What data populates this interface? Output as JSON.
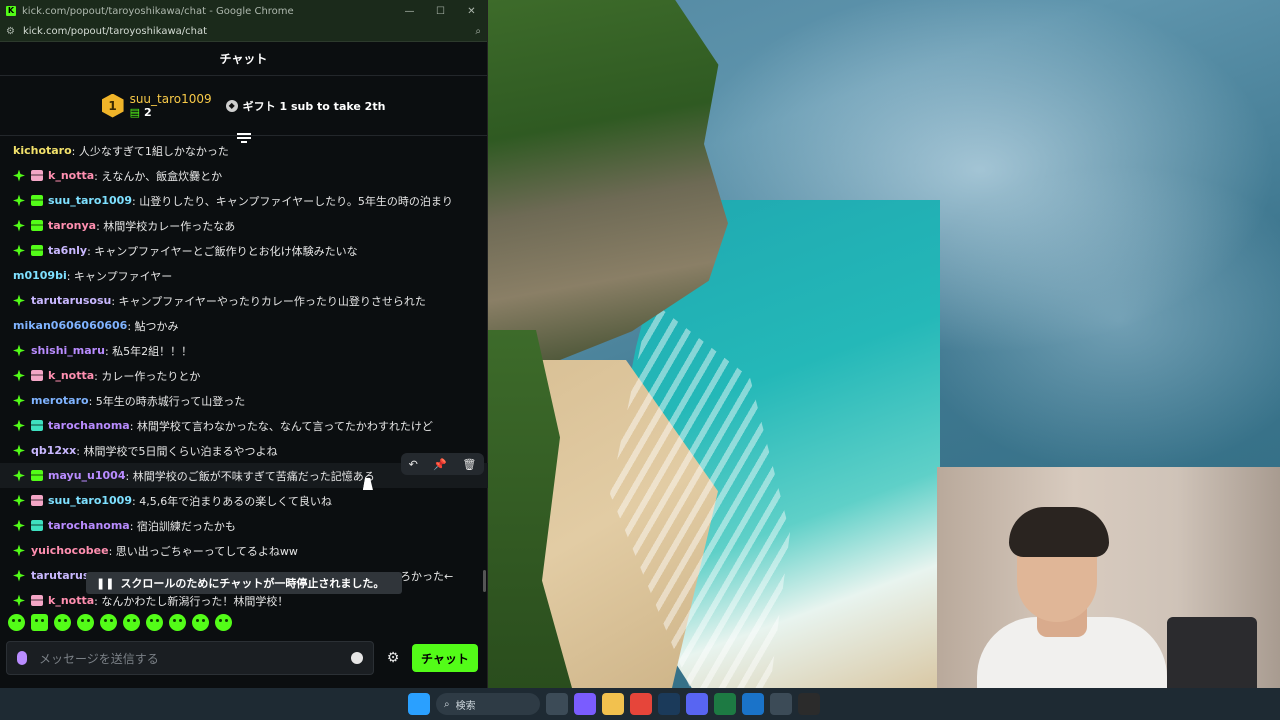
{
  "window": {
    "title": "kick.com/popout/taroyoshikawa/chat - Google Chrome",
    "url": "kick.com/popout/taroyoshikawa/chat"
  },
  "chat": {
    "header": "チャット",
    "leaderboard": {
      "rank": "1",
      "top_user": "suu_taro1009",
      "top_count": "2",
      "gift_cta": "ギフト 1 sub to take 2th"
    },
    "messages": [
      {
        "user": "kichotaro",
        "text": "人少なすぎて1組しかなかった",
        "badge": "",
        "gift": "",
        "color": "yellow-name"
      },
      {
        "user": "k_notta",
        "text": "えなんか、飯盒炊爨とか",
        "badge": "diamond",
        "gift": "pink",
        "color": "pink-name"
      },
      {
        "user": "suu_taro1009",
        "text": "山登りしたり、キャンプファイヤーしたり。5年生の時の泊まり",
        "badge": "diamond",
        "gift": "green",
        "color": "cyan-name"
      },
      {
        "user": "taronya",
        "text": "林間学校カレー作ったなあ",
        "badge": "diamond",
        "gift": "green",
        "color": "pink-name"
      },
      {
        "user": "ta6nly",
        "text": "キャンプファイヤーとご飯作りとお化け体験みたいな",
        "badge": "diamond",
        "gift": "green",
        "color": "lavender-name"
      },
      {
        "user": "m0109bi",
        "text": "キャンプファイヤー",
        "badge": "",
        "gift": "",
        "color": "cyan-name"
      },
      {
        "user": "tarutarusosu",
        "text": "キャンプファイヤーやったりカレー作ったり山登りさせられた",
        "badge": "diamond",
        "gift": "",
        "color": "lavender-name"
      },
      {
        "user": "mikan0606060606",
        "text": "鮎つかみ",
        "badge": "",
        "gift": "",
        "color": "blue-name"
      },
      {
        "user": "shishi_maru",
        "text": "私5年2組！！！",
        "badge": "diamond",
        "gift": "",
        "color": "purple-name"
      },
      {
        "user": "k_notta",
        "text": "カレー作ったりとか",
        "badge": "diamond",
        "gift": "pink",
        "color": "pink-name"
      },
      {
        "user": "merotaro",
        "text": "5年生の時赤城行って山登った",
        "badge": "diamond",
        "gift": "",
        "color": "blue-name"
      },
      {
        "user": "tarochanoma",
        "text": "林間学校て言わなかったな、なんて言ってたかわすれたけど",
        "badge": "diamond",
        "gift": "teal",
        "color": "purple-name"
      },
      {
        "user": "qb12xx",
        "text": "林間学校で5日間くらい泊まるやつよね",
        "badge": "diamond",
        "gift": "",
        "color": "lavender-name"
      },
      {
        "user": "mayu_u1004",
        "text": "林間学校のご飯が不味すぎて苦痛だった記憶ある",
        "badge": "diamond",
        "gift": "green",
        "color": "purple-name"
      },
      {
        "user": "suu_taro1009",
        "text": "4,5,6年で泊まりあるの楽しくて良いね",
        "badge": "diamond",
        "gift": "pink",
        "color": "cyan-name"
      },
      {
        "user": "tarochanoma",
        "text": "宿泊訓練だったかも",
        "badge": "diamond",
        "gift": "teal",
        "color": "purple-name"
      },
      {
        "user": "yuichocobee",
        "text": "思い出っごちゃーってしてるよねww",
        "badge": "diamond",
        "gift": "",
        "color": "pink-name"
      },
      {
        "user": "tarutarusosu",
        "text": "",
        "badge": "diamond",
        "gift": "",
        "color": "lavender-name"
      },
      {
        "user": "k_notta",
        "text": "なんかわたし新潟行った！林間学校！",
        "badge": "diamond",
        "gift": "pink",
        "color": "pink-name"
      }
    ],
    "overflow_text": "ろかった←",
    "paused_notice": "スクロールのためにチャットが一時停止されました。",
    "input_placeholder": "メッセージを送信する",
    "send_label": "チャット"
  },
  "taskbar": {
    "search_label": "検索"
  },
  "colors": {
    "accent": "#53fc18",
    "bg": "#0b0e10"
  }
}
